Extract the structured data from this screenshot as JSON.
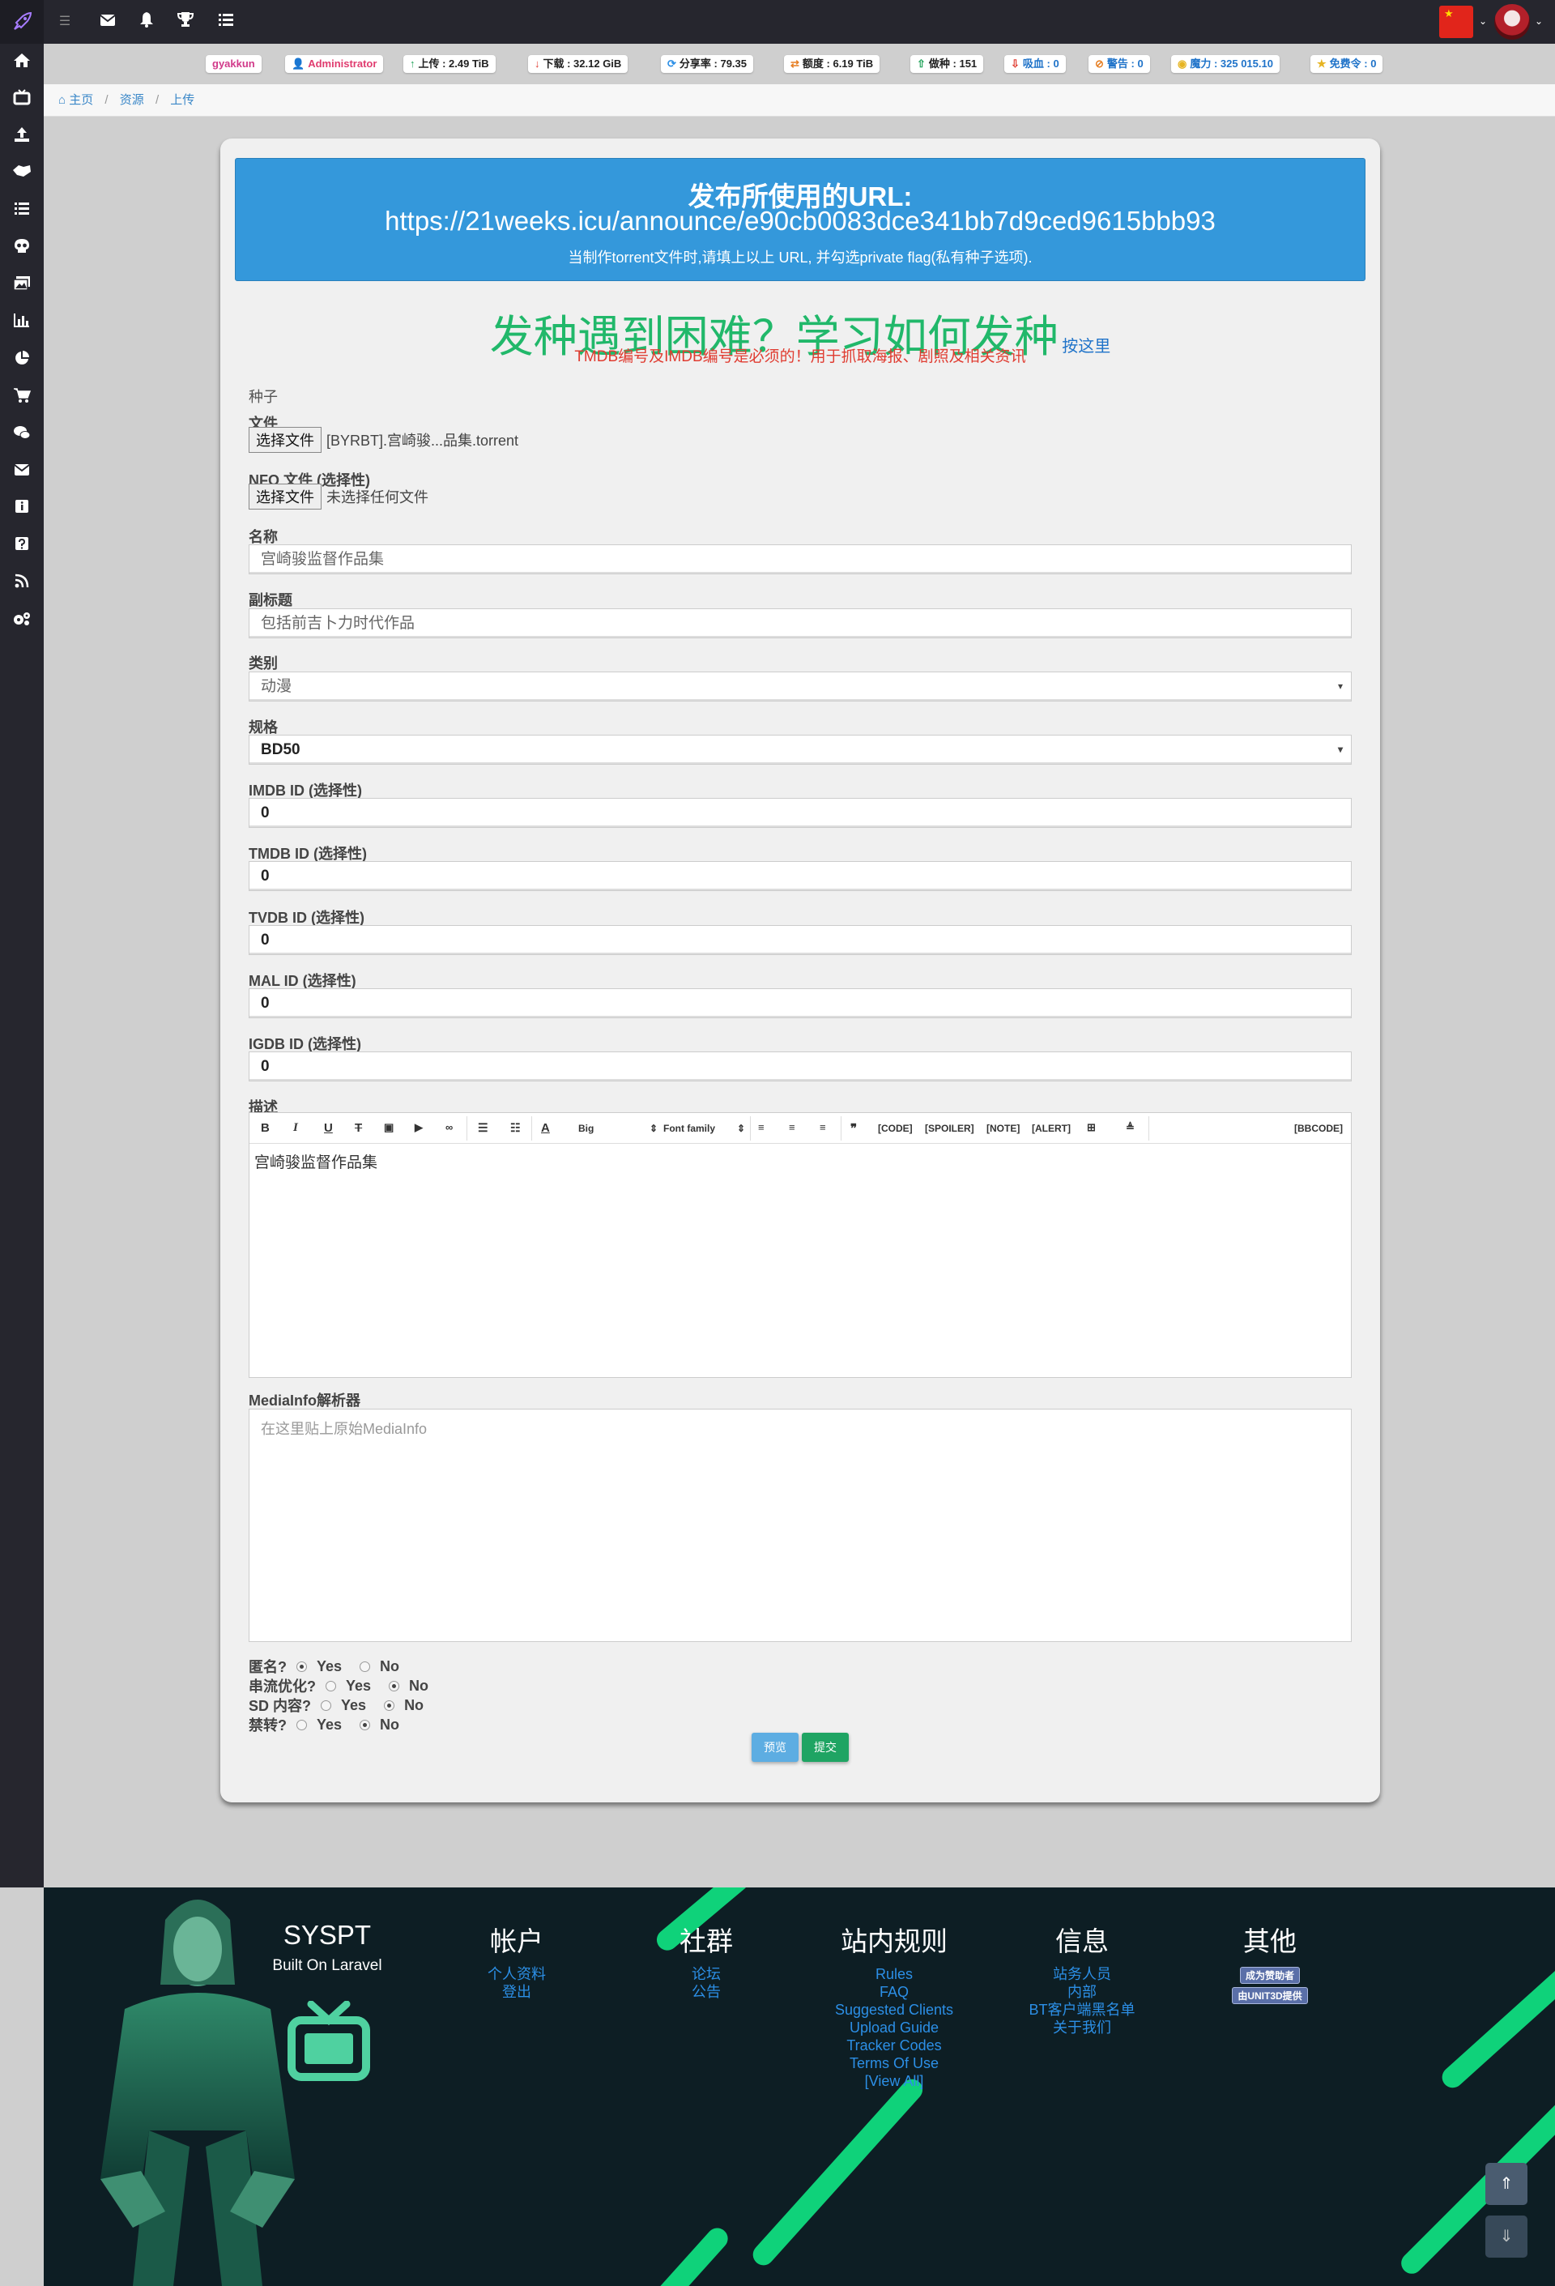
{
  "topbar": {
    "icons": [
      "menu-icon",
      "envelope-icon",
      "bell-icon",
      "trophy-icon",
      "list-check-icon"
    ]
  },
  "sidebar": {
    "icons": [
      "home-icon",
      "tv-icon",
      "upload-icon",
      "handshake-icon",
      "list-icon",
      "skull-icon",
      "images-icon",
      "bar-chart-icon",
      "pie-chart-icon",
      "cart-icon",
      "comments-icon",
      "envelope-icon",
      "info-icon",
      "question-icon",
      "rss-icon",
      "cogs-icon"
    ]
  },
  "stats": {
    "username": "gyakkun",
    "role": "Administrator",
    "upload": "上传 : 2.49 TiB",
    "download": "下载 : 32.12 GiB",
    "ratio": "分享率 : 79.35",
    "buffer": "额度 : 6.19 TiB",
    "seeding": "做种 : 151",
    "leeching": "吸血 : 0",
    "warnings": "警告 : 0",
    "bonus": "魔力 : 325 015.10",
    "freeleech": "免费令 : 0"
  },
  "breadcrumb": {
    "home": "主页",
    "torrents": "资源",
    "upload": "上传"
  },
  "announce": {
    "title": "发布所使用的URL:",
    "url": "https://21weeks.icu/announce/e90cb0083dce341bb7d9ced9615bbb93",
    "note": "当制作torrent文件时,请填上以上 URL, 并勾选private flag(私有种子选项)."
  },
  "help": {
    "title": "发种遇到困难？学习如何发种",
    "link": "按这里",
    "warning": "TMDB编号及IMDB编号是必须的！用于抓取海报、剧照及相关资讯"
  },
  "form": {
    "section_label": "种子",
    "file_label": "文件",
    "file_button": "选择文件",
    "file_value": "[BYRBT].宫崎骏...品集.torrent",
    "nfo_label": "NFO 文件 (选择性)",
    "nfo_button": "选择文件",
    "nfo_value": "未选择任何文件",
    "name_label": "名称",
    "name_value": "宫崎骏监督作品集",
    "subtitle_label": "副标题",
    "subtitle_value": "包括前吉卜力时代作品",
    "category_label": "类别",
    "category_value": "动漫",
    "type_label": "规格",
    "type_value": "BD50",
    "imdb_label": "IMDB ID (选择性)",
    "imdb_value": "0",
    "tmdb_label": "TMDB ID (选择性)",
    "tmdb_value": "0",
    "tvdb_label": "TVDB ID (选择性)",
    "tvdb_value": "0",
    "mal_label": "MAL ID (选择性)",
    "mal_value": "0",
    "igdb_label": "IGDB ID (选择性)",
    "igdb_value": "0",
    "description_label": "描述",
    "description_value": "宫崎骏监督作品集",
    "mediainfo_label": "MediaInfo解析器",
    "mediainfo_placeholder": "在这里贴上原始MediaInfo",
    "anonymous_label": "匿名?",
    "stream_label": "串流优化?",
    "sd_label": "SD 内容?",
    "internal_label": "禁转?",
    "yes": "Yes",
    "no": "No",
    "preview_button": "预览",
    "submit_button": "提交"
  },
  "editor_toolbar": {
    "bold": "B",
    "italic": "I",
    "underline": "U",
    "strike": "T",
    "size": "Big",
    "font": "Font family",
    "code": "[CODE]",
    "spoiler": "[SPOILER]",
    "note": "[NOTE]",
    "alert": "[ALERT]",
    "bbcode": "[BBCODE]"
  },
  "footer": {
    "site_name": "SYSPT",
    "site_sub": "Built On Laravel",
    "account_title": "帐户",
    "account_links": [
      "个人资料",
      "登出"
    ],
    "community_title": "社群",
    "community_links": [
      "论坛",
      "公告"
    ],
    "rules_title": "站内规则",
    "rules_links": [
      "Rules",
      "FAQ",
      "Suggested Clients",
      "Upload Guide",
      "Tracker Codes",
      "Terms Of Use",
      "[View All]"
    ],
    "info_title": "信息",
    "info_links": [
      "站务人员",
      "内部",
      "BT客户端黑名单",
      "关于我们"
    ],
    "other_title": "其他",
    "other_badges": [
      "成为赞助者",
      "由UNIT3D提供"
    ]
  },
  "colors": {
    "accent_green": "#21b86a",
    "announce_blue": "#3498db",
    "link_blue": "#2c8fe6",
    "danger": "#e03c31"
  }
}
